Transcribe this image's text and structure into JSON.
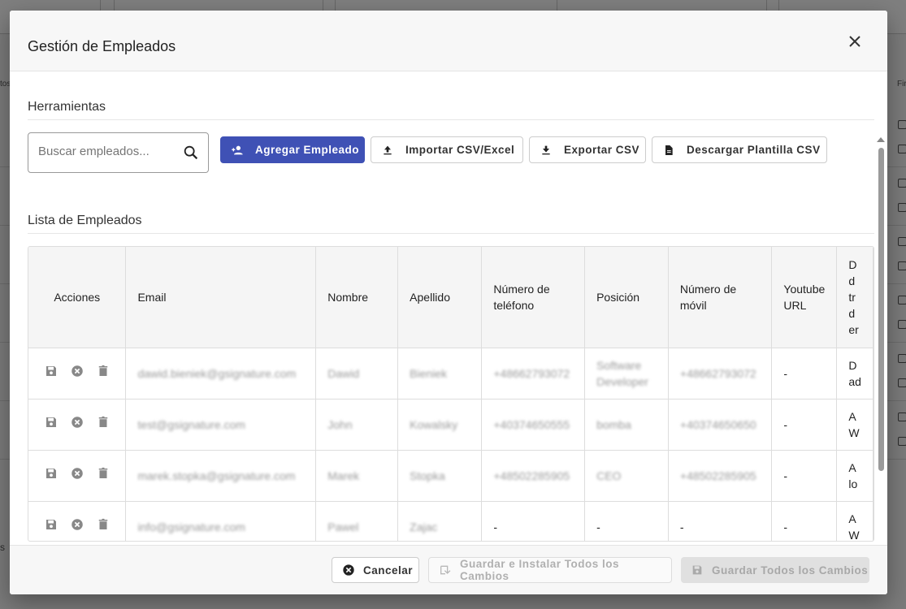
{
  "background": {
    "side_left_top": "tos",
    "side_right_top": "Fir",
    "side_left_bottom": "s"
  },
  "dialog": {
    "title": "Gestión de Empleados",
    "close_icon": "close-icon"
  },
  "tools": {
    "section_title": "Herramientas",
    "search_placeholder": "Buscar empleados...",
    "buttons": {
      "add": "Agregar Empleado",
      "import": "Importar CSV/Excel",
      "export": "Exportar CSV",
      "template": "Descargar Plantilla CSV"
    }
  },
  "list": {
    "section_title": "Lista de Empleados",
    "columns": {
      "actions": "Acciones",
      "email": "Email",
      "first_name": "Nombre",
      "last_name": "Apellido",
      "phone_1": "Número de",
      "phone_2": "teléfono",
      "position": "Posición",
      "mobile_1": "Número de",
      "mobile_2": "móvil",
      "youtube_1": "Youtube",
      "youtube_2": "URL",
      "last_1": "D",
      "last_2": "d",
      "last_3": "tr",
      "last_4": "d",
      "last_5": "er"
    },
    "rows": [
      {
        "email": "dawid.bieniek@gsignature.com",
        "first": "Dawid",
        "last": "Bieniek",
        "phone": "+48662793072",
        "position_1": "Software",
        "position_2": "Developer",
        "mobile": "+48662793072",
        "youtube": "-",
        "extra_1": "D",
        "extra_2": "ad"
      },
      {
        "email": "test@gsignature.com",
        "first": "John",
        "last": "Kowalsky",
        "phone": "+40374650555",
        "position_1": "bomba",
        "position_2": "",
        "mobile": "+40374650650",
        "youtube": "-",
        "extra_1": "A",
        "extra_2": "W"
      },
      {
        "email": "marek.stopka@gsignature.com",
        "first": "Marek",
        "last": "Stopka",
        "phone": "+48502285905",
        "position_1": "CEO",
        "position_2": "",
        "mobile": "+48502285905",
        "youtube": "-",
        "extra_1": "A",
        "extra_2": "lo"
      },
      {
        "email": "info@gsignature.com",
        "first": "Pawel",
        "last": "Zajac",
        "phone": "-",
        "position_1": "-",
        "position_2": "",
        "mobile": "-",
        "youtube": "-",
        "extra_1": "A",
        "extra_2": "W"
      }
    ]
  },
  "footer": {
    "cancel": "Cancelar",
    "save_install": "Guardar e Instalar Todos los Cambios",
    "save_all": "Guardar Todos los Cambios"
  },
  "colors": {
    "primary": "#3f51b5",
    "disabled_text": "#b0b0b0"
  }
}
